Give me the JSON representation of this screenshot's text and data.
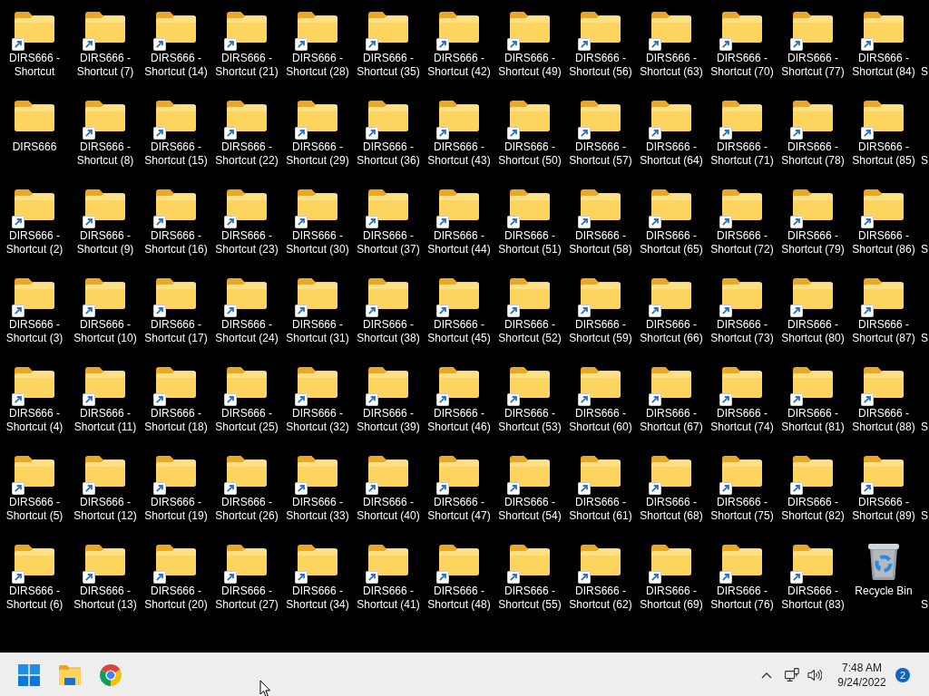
{
  "desktop": {
    "icons": [
      {
        "kind": "folder",
        "label": "DIRS666 - Shortcut",
        "shortcut": true
      },
      {
        "kind": "folder",
        "label": "DIRS666",
        "shortcut": false
      },
      {
        "kind": "folder",
        "label": "DIRS666 - Shortcut (2)",
        "shortcut": true
      },
      {
        "kind": "folder",
        "label": "DIRS666 - Shortcut (3)",
        "shortcut": true
      },
      {
        "kind": "folder",
        "label": "DIRS666 - Shortcut (4)",
        "shortcut": true
      },
      {
        "kind": "folder",
        "label": "DIRS666 - Shortcut (5)",
        "shortcut": true
      },
      {
        "kind": "folder",
        "label": "DIRS666 - Shortcut (6)",
        "shortcut": true
      },
      {
        "kind": "folder",
        "label": "DIRS666 - Shortcut (7)",
        "shortcut": true
      },
      {
        "kind": "folder",
        "label": "DIRS666 - Shortcut (8)",
        "shortcut": true
      },
      {
        "kind": "folder",
        "label": "DIRS666 - Shortcut (9)",
        "shortcut": true
      },
      {
        "kind": "folder",
        "label": "DIRS666 - Shortcut (10)",
        "shortcut": true
      },
      {
        "kind": "folder",
        "label": "DIRS666 - Shortcut (11)",
        "shortcut": true
      },
      {
        "kind": "folder",
        "label": "DIRS666 - Shortcut (12)",
        "shortcut": true
      },
      {
        "kind": "folder",
        "label": "DIRS666 - Shortcut (13)",
        "shortcut": true
      },
      {
        "kind": "folder",
        "label": "DIRS666 - Shortcut (14)",
        "shortcut": true
      },
      {
        "kind": "folder",
        "label": "DIRS666 - Shortcut (15)",
        "shortcut": true
      },
      {
        "kind": "folder",
        "label": "DIRS666 - Shortcut (16)",
        "shortcut": true
      },
      {
        "kind": "folder",
        "label": "DIRS666 - Shortcut (17)",
        "shortcut": true
      },
      {
        "kind": "folder",
        "label": "DIRS666 - Shortcut (18)",
        "shortcut": true
      },
      {
        "kind": "folder",
        "label": "DIRS666 - Shortcut (19)",
        "shortcut": true
      },
      {
        "kind": "folder",
        "label": "DIRS666 - Shortcut (20)",
        "shortcut": true
      },
      {
        "kind": "folder",
        "label": "DIRS666 - Shortcut (21)",
        "shortcut": true
      },
      {
        "kind": "folder",
        "label": "DIRS666 - Shortcut (22)",
        "shortcut": true
      },
      {
        "kind": "folder",
        "label": "DIRS666 - Shortcut (23)",
        "shortcut": true
      },
      {
        "kind": "folder",
        "label": "DIRS666 - Shortcut (24)",
        "shortcut": true
      },
      {
        "kind": "folder",
        "label": "DIRS666 - Shortcut (25)",
        "shortcut": true
      },
      {
        "kind": "folder",
        "label": "DIRS666 - Shortcut (26)",
        "shortcut": true
      },
      {
        "kind": "folder",
        "label": "DIRS666 - Shortcut (27)",
        "shortcut": true
      },
      {
        "kind": "folder",
        "label": "DIRS666 - Shortcut (28)",
        "shortcut": true
      },
      {
        "kind": "folder",
        "label": "DIRS666 - Shortcut (29)",
        "shortcut": true
      },
      {
        "kind": "folder",
        "label": "DIRS666 - Shortcut (30)",
        "shortcut": true
      },
      {
        "kind": "folder",
        "label": "DIRS666 - Shortcut (31)",
        "shortcut": true
      },
      {
        "kind": "folder",
        "label": "DIRS666 - Shortcut (32)",
        "shortcut": true
      },
      {
        "kind": "folder",
        "label": "DIRS666 - Shortcut (33)",
        "shortcut": true
      },
      {
        "kind": "folder",
        "label": "DIRS666 - Shortcut (34)",
        "shortcut": true
      },
      {
        "kind": "folder",
        "label": "DIRS666 - Shortcut (35)",
        "shortcut": true
      },
      {
        "kind": "folder",
        "label": "DIRS666 - Shortcut (36)",
        "shortcut": true
      },
      {
        "kind": "folder",
        "label": "DIRS666 - Shortcut (37)",
        "shortcut": true
      },
      {
        "kind": "folder",
        "label": "DIRS666 - Shortcut (38)",
        "shortcut": true
      },
      {
        "kind": "folder",
        "label": "DIRS666 - Shortcut (39)",
        "shortcut": true
      },
      {
        "kind": "folder",
        "label": "DIRS666 - Shortcut (40)",
        "shortcut": true
      },
      {
        "kind": "folder",
        "label": "DIRS666 - Shortcut (41)",
        "shortcut": true
      },
      {
        "kind": "folder",
        "label": "DIRS666 - Shortcut (42)",
        "shortcut": true
      },
      {
        "kind": "folder",
        "label": "DIRS666 - Shortcut (43)",
        "shortcut": true
      },
      {
        "kind": "folder",
        "label": "DIRS666 - Shortcut (44)",
        "shortcut": true
      },
      {
        "kind": "folder",
        "label": "DIRS666 - Shortcut (45)",
        "shortcut": true
      },
      {
        "kind": "folder",
        "label": "DIRS666 - Shortcut (46)",
        "shortcut": true
      },
      {
        "kind": "folder",
        "label": "DIRS666 - Shortcut (47)",
        "shortcut": true
      },
      {
        "kind": "folder",
        "label": "DIRS666 - Shortcut (48)",
        "shortcut": true
      },
      {
        "kind": "folder",
        "label": "DIRS666 - Shortcut (49)",
        "shortcut": true
      },
      {
        "kind": "folder",
        "label": "DIRS666 - Shortcut (50)",
        "shortcut": true
      },
      {
        "kind": "folder",
        "label": "DIRS666 - Shortcut (51)",
        "shortcut": true
      },
      {
        "kind": "folder",
        "label": "DIRS666 - Shortcut (52)",
        "shortcut": true
      },
      {
        "kind": "folder",
        "label": "DIRS666 - Shortcut (53)",
        "shortcut": true
      },
      {
        "kind": "folder",
        "label": "DIRS666 - Shortcut (54)",
        "shortcut": true
      },
      {
        "kind": "folder",
        "label": "DIRS666 - Shortcut (55)",
        "shortcut": true
      },
      {
        "kind": "folder",
        "label": "DIRS666 - Shortcut (56)",
        "shortcut": true
      },
      {
        "kind": "folder",
        "label": "DIRS666 - Shortcut (57)",
        "shortcut": true
      },
      {
        "kind": "folder",
        "label": "DIRS666 - Shortcut (58)",
        "shortcut": true
      },
      {
        "kind": "folder",
        "label": "DIRS666 - Shortcut (59)",
        "shortcut": true
      },
      {
        "kind": "folder",
        "label": "DIRS666 - Shortcut (60)",
        "shortcut": true
      },
      {
        "kind": "folder",
        "label": "DIRS666 - Shortcut (61)",
        "shortcut": true
      },
      {
        "kind": "folder",
        "label": "DIRS666 - Shortcut (62)",
        "shortcut": true
      },
      {
        "kind": "folder",
        "label": "DIRS666 - Shortcut (63)",
        "shortcut": true
      },
      {
        "kind": "folder",
        "label": "DIRS666 - Shortcut (64)",
        "shortcut": true
      },
      {
        "kind": "folder",
        "label": "DIRS666 - Shortcut (65)",
        "shortcut": true
      },
      {
        "kind": "folder",
        "label": "DIRS666 - Shortcut (66)",
        "shortcut": true
      },
      {
        "kind": "folder",
        "label": "DIRS666 - Shortcut (67)",
        "shortcut": true
      },
      {
        "kind": "folder",
        "label": "DIRS666 - Shortcut (68)",
        "shortcut": true
      },
      {
        "kind": "folder",
        "label": "DIRS666 - Shortcut (69)",
        "shortcut": true
      },
      {
        "kind": "folder",
        "label": "DIRS666 - Shortcut (70)",
        "shortcut": true
      },
      {
        "kind": "folder",
        "label": "DIRS666 - Shortcut (71)",
        "shortcut": true
      },
      {
        "kind": "folder",
        "label": "DIRS666 - Shortcut (72)",
        "shortcut": true
      },
      {
        "kind": "folder",
        "label": "DIRS666 - Shortcut (73)",
        "shortcut": true
      },
      {
        "kind": "folder",
        "label": "DIRS666 - Shortcut (74)",
        "shortcut": true
      },
      {
        "kind": "folder",
        "label": "DIRS666 - Shortcut (75)",
        "shortcut": true
      },
      {
        "kind": "folder",
        "label": "DIRS666 - Shortcut (76)",
        "shortcut": true
      },
      {
        "kind": "folder",
        "label": "DIRS666 - Shortcut (77)",
        "shortcut": true
      },
      {
        "kind": "folder",
        "label": "DIRS666 - Shortcut (78)",
        "shortcut": true
      },
      {
        "kind": "folder",
        "label": "DIRS666 - Shortcut (79)",
        "shortcut": true
      },
      {
        "kind": "folder",
        "label": "DIRS666 - Shortcut (80)",
        "shortcut": true
      },
      {
        "kind": "folder",
        "label": "DIRS666 - Shortcut (81)",
        "shortcut": true
      },
      {
        "kind": "folder",
        "label": "DIRS666 - Shortcut (82)",
        "shortcut": true
      },
      {
        "kind": "folder",
        "label": "DIRS666 - Shortcut (83)",
        "shortcut": true
      },
      {
        "kind": "folder",
        "label": "DIRS666 - Shortcut (84)",
        "shortcut": true
      },
      {
        "kind": "folder",
        "label": "DIRS666 - Shortcut (85)",
        "shortcut": true
      },
      {
        "kind": "folder",
        "label": "DIRS666 - Shortcut (86)",
        "shortcut": true
      },
      {
        "kind": "folder",
        "label": "DIRS666 - Shortcut (87)",
        "shortcut": true
      },
      {
        "kind": "folder",
        "label": "DIRS666 - Shortcut (88)",
        "shortcut": true
      },
      {
        "kind": "folder",
        "label": "DIRS666 - Shortcut (89)",
        "shortcut": true
      },
      {
        "kind": "recycle_bin",
        "label": "Recycle Bin",
        "shortcut": false
      },
      {
        "kind": "partial",
        "label": "S"
      },
      {
        "kind": "partial",
        "label": "S"
      },
      {
        "kind": "partial",
        "label": "S"
      },
      {
        "kind": "partial",
        "label": "S"
      },
      {
        "kind": "partial",
        "label": "S"
      },
      {
        "kind": "partial",
        "label": "S"
      },
      {
        "kind": "partial",
        "label": "S"
      }
    ]
  },
  "taskbar": {
    "clock": {
      "time": "7:48 AM",
      "date": "9/24/2022"
    },
    "notification_count": "2"
  }
}
